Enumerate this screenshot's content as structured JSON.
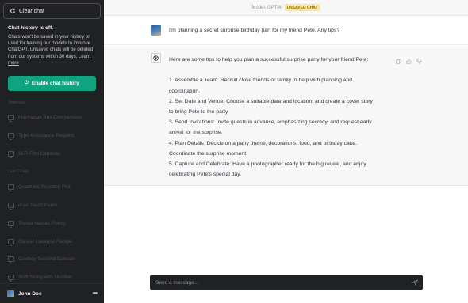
{
  "sidebar": {
    "clear_label": "Clear chat",
    "history_off_title": "Chat history is off.",
    "history_desc": "Chats won't be saved in your history or used for training our models to improve ChatGPT. Unsaved chats will be deleted from our systems within 30 days.",
    "learn_more": "Learn more",
    "enable_label": "Enable chat history",
    "sections": [
      {
        "label": "Yesterday",
        "items": [
          "Manhattan Bus Comparisons",
          "Typo Assistance Request",
          "SLR Film Cameras"
        ]
      },
      {
        "label": "Last 7 Days",
        "items": [
          "Quadratic Function Plot",
          "iPod Touch Poem",
          "Toyota Names Poetry",
          "Classic Lasagne Recipe",
          "Cowboy Seinfeld Episode",
          "Shift String with Number"
        ]
      }
    ],
    "user_name": "John Doe",
    "menu_icon": "ellipsis-icon"
  },
  "header": {
    "model_label": "Model: GPT-4",
    "badge": "UNSAVED CHAT"
  },
  "conversation": {
    "user_message": "I'm planning a secret surprise birthday part for my friend Pete. Any tips?",
    "assistant_intro": "Here are some tips to help you plan a successful surprise party for your friend Pete:",
    "assistant_lines": [
      "1. Assemble a Team: Recruit close friends or family to help with planning and",
      "coordination.",
      "2. Set Date and Venue: Choose a suitable date and location, and create a cover story",
      "to bring Pete to the party.",
      "3. Send Invitations: Invite guests in advance, emphasizing secrecy, and request early",
      "arrival for the surprise.",
      "4. Plan Details: Decide on a party theme, decorations, food, and birthday cake.",
      "Coordinate the surprise moment.",
      "5. Capture and Celebrate: Have a photographer ready for the big reveal, and enjoy",
      "celebrating Pete's special day."
    ]
  },
  "composer": {
    "placeholder": "Send a message..."
  },
  "colors": {
    "sidebar_bg": "#202123",
    "accent_green": "#10a37f",
    "badge_bg": "#fae69e"
  }
}
